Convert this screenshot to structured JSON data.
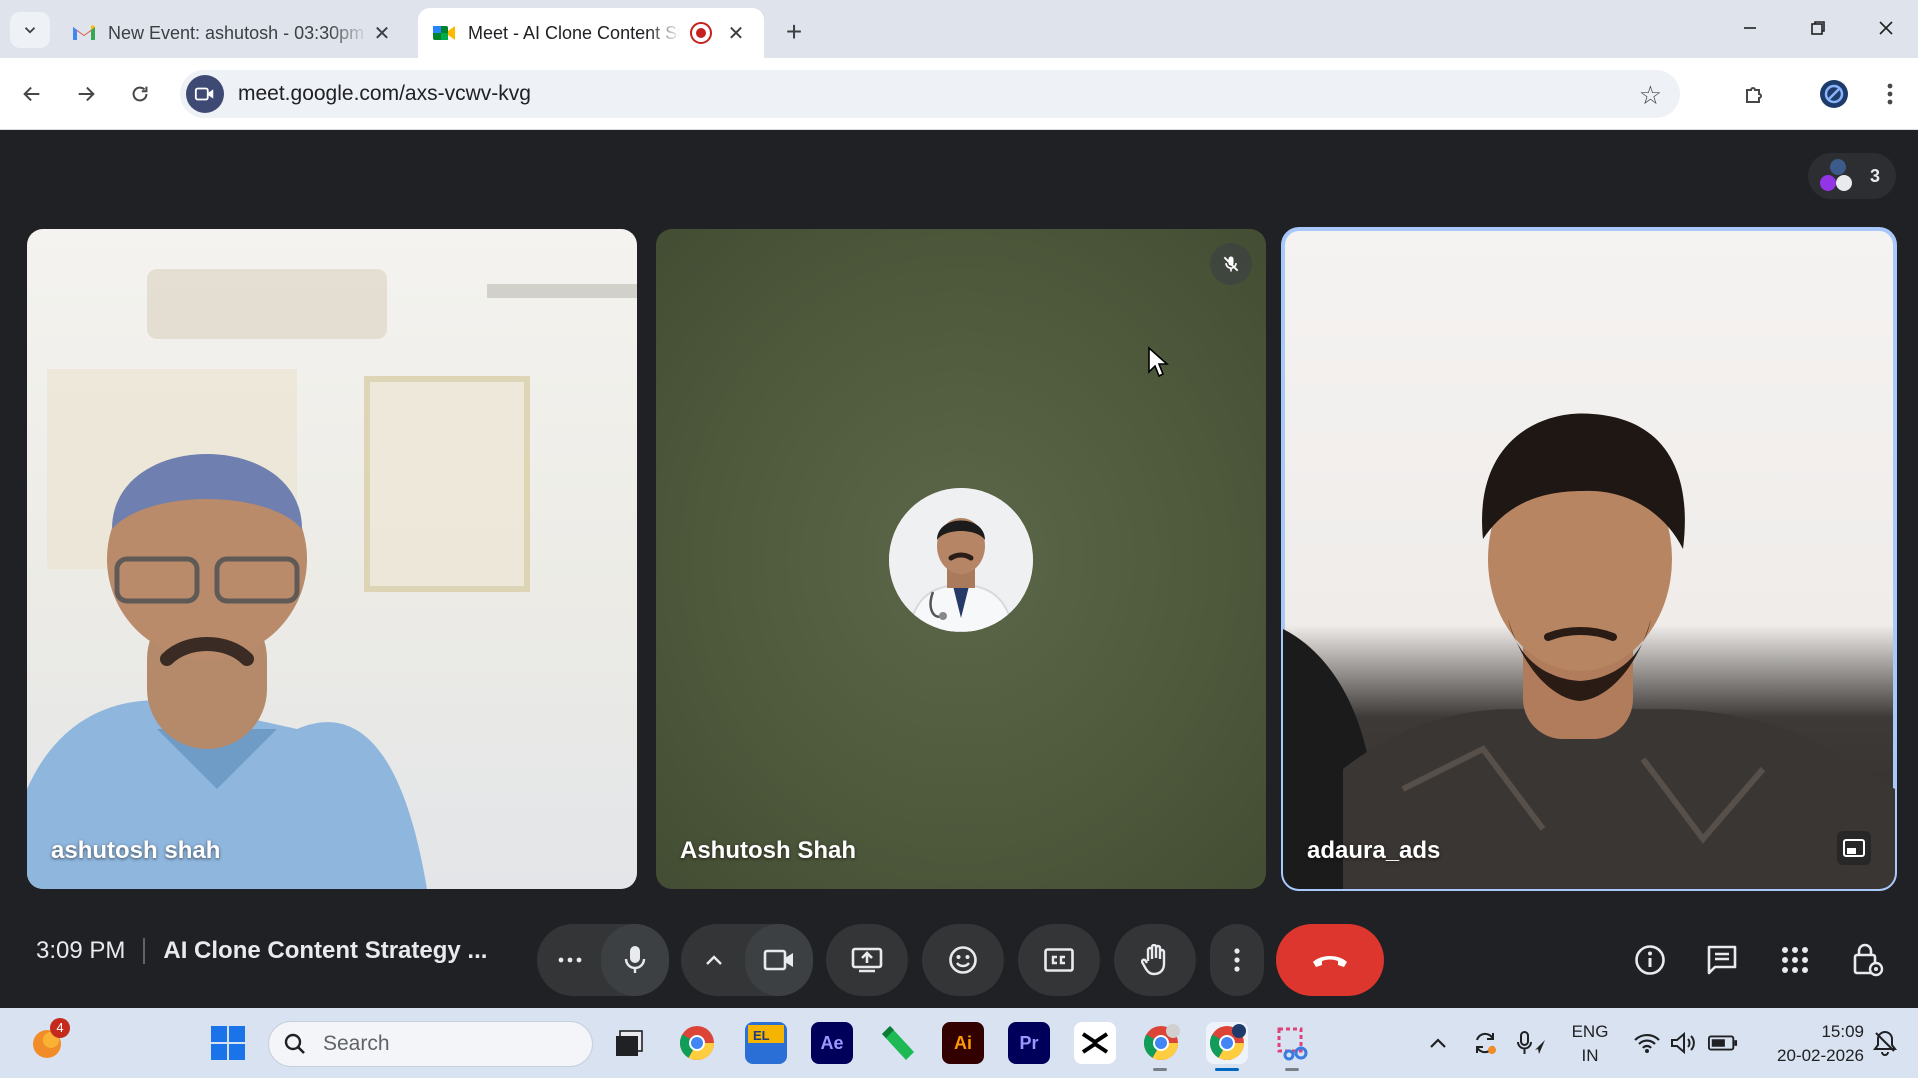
{
  "browser": {
    "tabs": [
      {
        "title": "New Event: ashutosh - 03:30pm",
        "icon": "gmail-icon",
        "active": false
      },
      {
        "title": "Meet - AI Clone Content Strategy",
        "icon": "google-meet-icon",
        "active": true,
        "recording": true
      }
    ],
    "url": "meet.google.com/axs-vcwv-kvg"
  },
  "meet": {
    "participants_count": "3",
    "tiles": [
      {
        "name": "ashutosh shah",
        "type": "video"
      },
      {
        "name": "Ashutosh Shah",
        "type": "avatar",
        "muted": true
      },
      {
        "name": "adaura_ads",
        "type": "video",
        "active_speaker": true
      }
    ],
    "time": "3:09 PM",
    "meeting_title": "AI Clone Content Strategy ...",
    "colors": {
      "background": "#202124",
      "control": "#333537",
      "end_call": "#dc362e",
      "speaker_outline": "#a8c7fa"
    }
  },
  "taskbar": {
    "search_placeholder": "Search",
    "notification_badge": "4",
    "apps": [
      "chrome-icon",
      "file-explorer-icon",
      "after-effects-icon",
      "illustrator-icon",
      "premiere-icon",
      "capcut-icon"
    ],
    "lang_top": "ENG",
    "lang_bottom": "IN",
    "time": "15:09",
    "date": "20-02-2026"
  }
}
